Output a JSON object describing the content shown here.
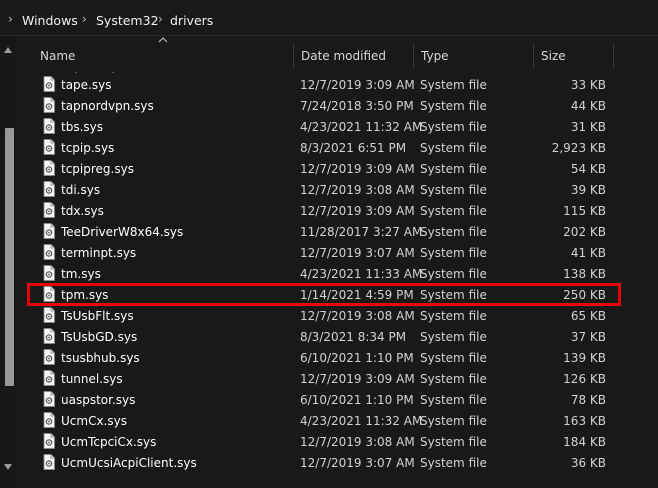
{
  "breadcrumb": {
    "items": [
      "Windows",
      "System32",
      "drivers"
    ]
  },
  "columns": {
    "name": "Name",
    "date": "Date modified",
    "type": "Type",
    "size": "Size"
  },
  "files": [
    {
      "name": "tape.sys",
      "date": "12/7/2019 3:09 AM",
      "type": "System file",
      "size": "33 KB"
    },
    {
      "name": "tapnordvpn.sys",
      "date": "7/24/2018 3:50 PM",
      "type": "System file",
      "size": "44 KB"
    },
    {
      "name": "tbs.sys",
      "date": "4/23/2021 11:32 AM",
      "type": "System file",
      "size": "31 KB"
    },
    {
      "name": "tcpip.sys",
      "date": "8/3/2021 6:51 PM",
      "type": "System file",
      "size": "2,923 KB"
    },
    {
      "name": "tcpipreg.sys",
      "date": "12/7/2019 3:09 AM",
      "type": "System file",
      "size": "54 KB"
    },
    {
      "name": "tdi.sys",
      "date": "12/7/2019 3:08 AM",
      "type": "System file",
      "size": "39 KB"
    },
    {
      "name": "tdx.sys",
      "date": "12/7/2019 3:09 AM",
      "type": "System file",
      "size": "115 KB"
    },
    {
      "name": "TeeDriverW8x64.sys",
      "date": "11/28/2017 3:27 AM",
      "type": "System file",
      "size": "202 KB"
    },
    {
      "name": "terminpt.sys",
      "date": "12/7/2019 3:07 AM",
      "type": "System file",
      "size": "41 KB"
    },
    {
      "name": "tm.sys",
      "date": "4/23/2021 11:33 AM",
      "type": "System file",
      "size": "138 KB"
    },
    {
      "name": "tpm.sys",
      "date": "1/14/2021 4:59 PM",
      "type": "System file",
      "size": "250 KB",
      "selected": true
    },
    {
      "name": "TsUsbFlt.sys",
      "date": "12/7/2019 3:08 AM",
      "type": "System file",
      "size": "65 KB"
    },
    {
      "name": "TsUsbGD.sys",
      "date": "8/3/2021 8:34 PM",
      "type": "System file",
      "size": "37 KB"
    },
    {
      "name": "tsusbhub.sys",
      "date": "6/10/2021 1:10 PM",
      "type": "System file",
      "size": "139 KB"
    },
    {
      "name": "tunnel.sys",
      "date": "12/7/2019 3:09 AM",
      "type": "System file",
      "size": "126 KB"
    },
    {
      "name": "uaspstor.sys",
      "date": "6/10/2021 1:10 PM",
      "type": "System file",
      "size": "78 KB"
    },
    {
      "name": "UcmCx.sys",
      "date": "4/23/2021 11:32 AM",
      "type": "System file",
      "size": "163 KB"
    },
    {
      "name": "UcmTcpciCx.sys",
      "date": "12/7/2019 3:08 AM",
      "type": "System file",
      "size": "184 KB"
    },
    {
      "name": "UcmUcsiAcpiClient.sys",
      "date": "12/7/2019 3:07 AM",
      "type": "System file",
      "size": "36 KB"
    }
  ],
  "colors": {
    "background": "#191919",
    "highlight_border": "#e8000b"
  },
  "icons": {
    "file": "system-file-icon",
    "breadcrumb_separator": "chevron-right-icon",
    "sort": "chevron-up-icon"
  }
}
